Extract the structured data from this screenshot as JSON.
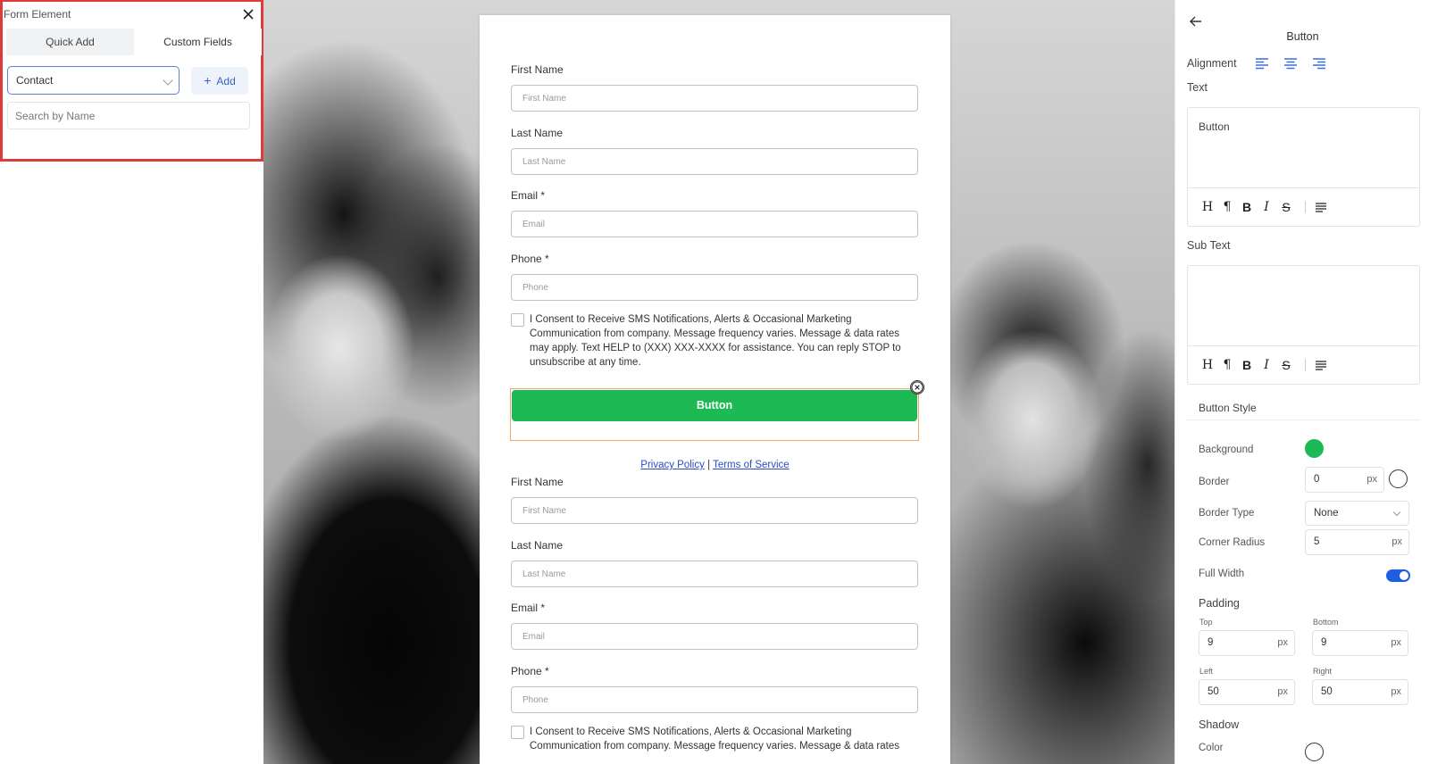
{
  "left_panel": {
    "title": "Form Element",
    "tabs": [
      {
        "label": "Quick Add"
      },
      {
        "label": "Custom Fields"
      }
    ],
    "select_value": "Contact",
    "add_label": "Add",
    "search_placeholder": "Search by Name"
  },
  "form": {
    "fields_1": [
      {
        "label": "First Name",
        "placeholder": "First Name"
      },
      {
        "label": "Last Name",
        "placeholder": "Last Name"
      },
      {
        "label": "Email *",
        "placeholder": "Email"
      },
      {
        "label": "Phone *",
        "placeholder": "Phone"
      }
    ],
    "consent_text": "I Consent to Receive SMS Notifications, Alerts & Occasional Marketing Communication from company. Message frequency varies. Message & data rates may apply. Text HELP to (XXX) XXX-XXXX for assistance. You can reply STOP to unsubscribe at any time.",
    "button_label": "Button",
    "privacy_label": "Privacy Policy",
    "separator": "|",
    "terms_label": "Terms of Service",
    "fields_2": [
      {
        "label": "First Name",
        "placeholder": "First Name"
      },
      {
        "label": "Last Name",
        "placeholder": "Last Name"
      },
      {
        "label": "Email *",
        "placeholder": "Email"
      },
      {
        "label": "Phone *",
        "placeholder": "Phone"
      }
    ],
    "consent_text_2": "I Consent to Receive SMS Notifications, Alerts & Occasional Marketing Communication from company. Message frequency varies. Message & data rates"
  },
  "right_panel": {
    "title": "Button",
    "alignment_label": "Alignment",
    "text_label": "Text",
    "text_value": "Button",
    "subtext_label": "Sub Text",
    "subtext_value": "",
    "toolbar": {
      "heading": "H",
      "paragraph": "¶",
      "bold": "B",
      "italic": "I",
      "strike": "S"
    },
    "button_style_label": "Button Style",
    "background_label": "Background",
    "background_color": "#1db954",
    "border_label": "Border",
    "border_value": "0",
    "border_color": "#ffffff",
    "border_type_label": "Border Type",
    "border_type_value": "None",
    "corner_radius_label": "Corner Radius",
    "corner_radius_value": "5",
    "full_width_label": "Full Width",
    "full_width_on": true,
    "padding_label": "Padding",
    "padding": {
      "top_label": "Top",
      "top": "9",
      "bottom_label": "Bottom",
      "bottom": "9",
      "left_label": "Left",
      "left": "50",
      "right_label": "Right",
      "right": "50"
    },
    "unit": "px",
    "shadow_label": "Shadow",
    "color_label": "Color"
  }
}
